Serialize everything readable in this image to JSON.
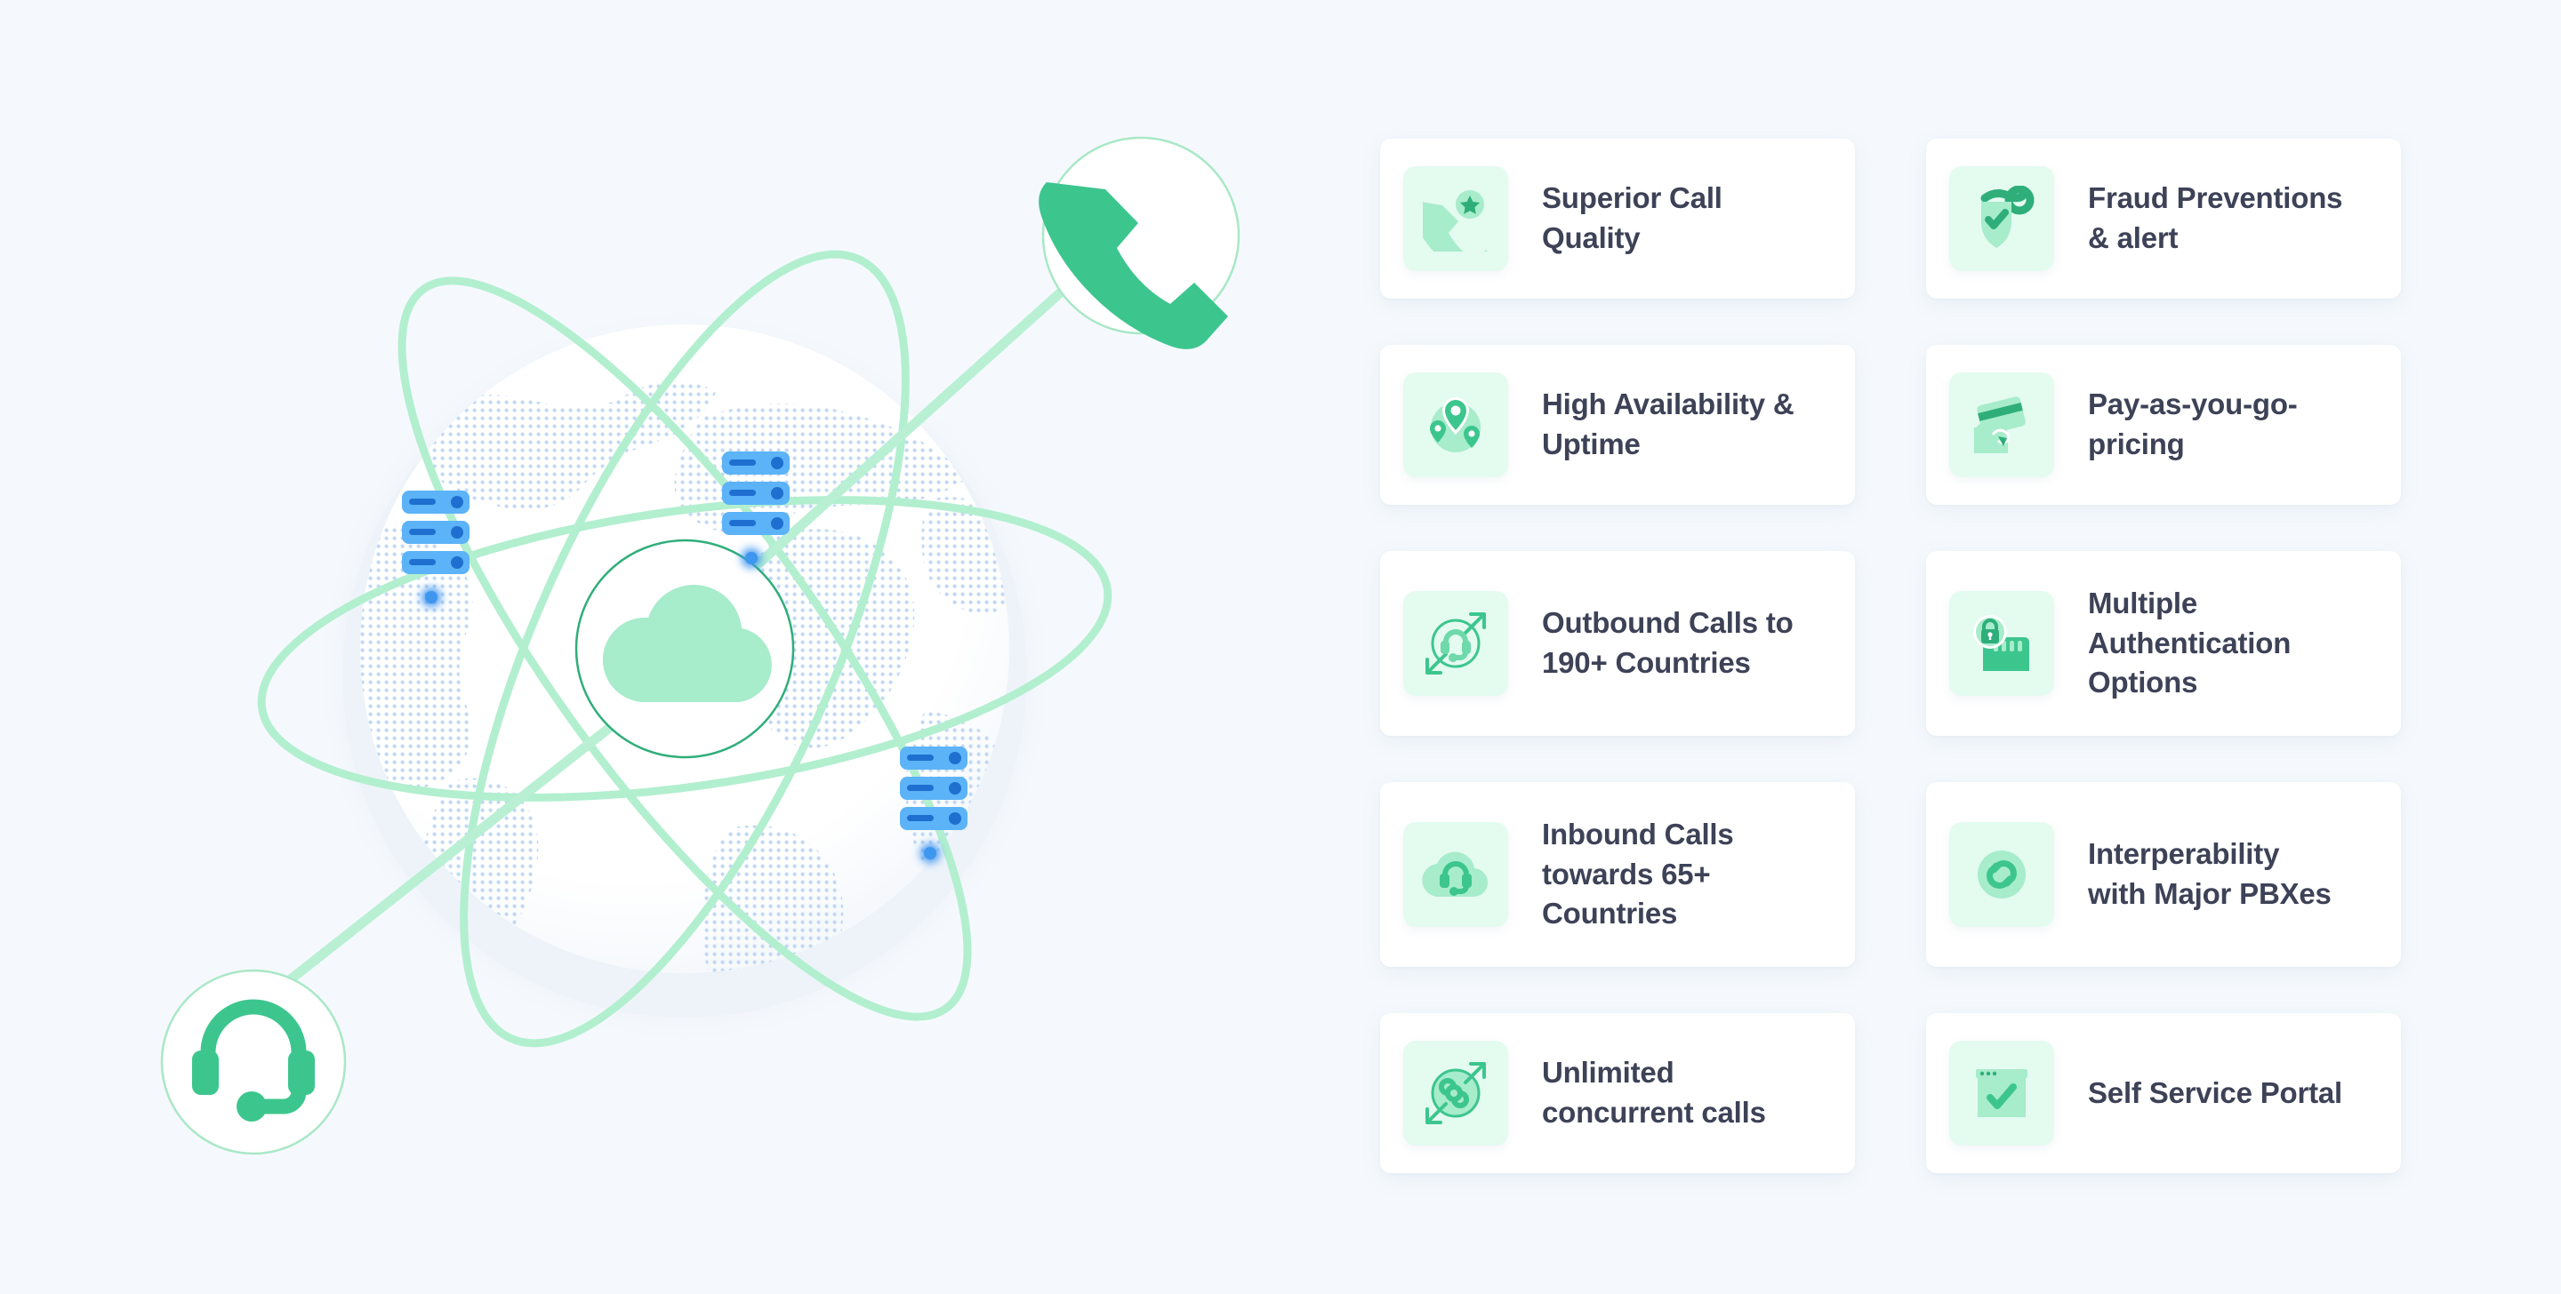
{
  "colors": {
    "background": "#f5f9fd",
    "card_background": "#ffffff",
    "icon_tile": "#e4fbf0",
    "accent_green": "#3cc68e",
    "accent_green_light": "#a7eccb",
    "orbit_green": "#b2efcf",
    "text": "#3d4257",
    "server_blue": "#5cb3f7",
    "server_blue_dark": "#1f6fd0",
    "globe_dots": "#bcd6f5"
  },
  "illustration": {
    "name": "global-cloud-network-illustration",
    "globe": {
      "label": "world-globe",
      "center_badge_icon": "cloud-icon"
    },
    "orbits": 3,
    "servers": [
      {
        "icon": "server-stack-icon",
        "pin": "signal-dot"
      },
      {
        "icon": "server-stack-icon",
        "pin": "signal-dot"
      },
      {
        "icon": "server-stack-icon",
        "pin": "signal-dot"
      }
    ],
    "badges": [
      {
        "icon": "phone-icon",
        "position": "top-right"
      },
      {
        "icon": "headset-icon",
        "position": "bottom-left"
      }
    ]
  },
  "features": {
    "columns": 2,
    "items": [
      {
        "icon": "phone-star-icon",
        "label": "Superior Call\nQuality",
        "column": "left"
      },
      {
        "icon": "shield-check-key-icon",
        "label": "Fraud Preventions\n& alert",
        "column": "right"
      },
      {
        "icon": "map-pins-icon",
        "label": "High Availability &\nUptime",
        "column": "left"
      },
      {
        "icon": "credit-card-hand-icon",
        "label": "Pay-as-you-go-\npricing",
        "column": "right"
      },
      {
        "icon": "outbound-headset-icon",
        "label": "Outbound Calls to\n190+ Countries",
        "column": "left"
      },
      {
        "icon": "lock-keypad-icon",
        "label": "Multiple\nAuthentication\nOptions",
        "column": "right"
      },
      {
        "icon": "cloud-headset-icon",
        "label": "Inbound Calls\ntowards 65+\nCountries",
        "column": "left"
      },
      {
        "icon": "chain-link-icon",
        "label": "Interperability\nwith Major PBXes",
        "column": "right"
      },
      {
        "icon": "infinity-expand-icon",
        "label": "Unlimited\nconcurrent calls",
        "column": "left"
      },
      {
        "icon": "browser-check-icon",
        "label": "Self Service Portal",
        "column": "right"
      }
    ]
  }
}
